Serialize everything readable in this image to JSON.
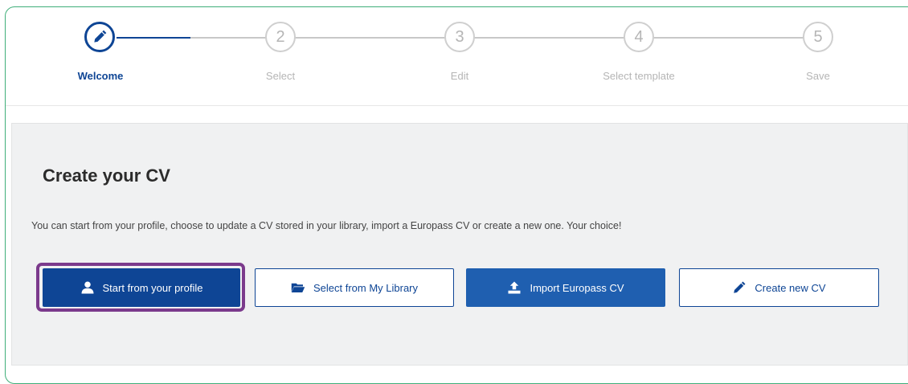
{
  "stepper": {
    "steps": [
      {
        "number": "",
        "label": "Welcome",
        "icon": "pencil-icon",
        "state": "active"
      },
      {
        "number": "2",
        "label": "Select",
        "state": "inactive"
      },
      {
        "number": "3",
        "label": "Edit",
        "state": "inactive"
      },
      {
        "number": "4",
        "label": "Select template",
        "state": "inactive"
      },
      {
        "number": "5",
        "label": "Save",
        "state": "inactive"
      }
    ],
    "active_color": "#0e4595",
    "inactive_color": "#c8c8c8"
  },
  "panel": {
    "title": "Create your CV",
    "description": "You can start from your profile, choose to update a CV stored in your library, import a Europass CV or create a new one. Your choice!"
  },
  "actions": {
    "start_profile": {
      "label": "Start from your profile",
      "icon": "user-icon"
    },
    "select_library": {
      "label": "Select from My Library",
      "icon": "folder-open-icon"
    },
    "import_cv": {
      "label": "Import Europass CV",
      "icon": "upload-icon"
    },
    "create_new": {
      "label": "Create new CV",
      "icon": "pencil-icon"
    }
  },
  "colors": {
    "primary": "#0e4595",
    "import": "#1f5fb0",
    "highlight": "#7b3a8c",
    "frame": "#3fae79"
  }
}
